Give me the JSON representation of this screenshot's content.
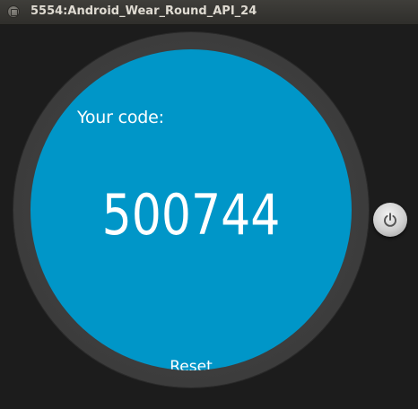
{
  "window": {
    "title": "5554:Android_Wear_Round_API_24",
    "close_icon": "window-close-icon"
  },
  "screen": {
    "background_color": "#0096c8",
    "prompt": "Your code:",
    "code": "500744",
    "reset_label": "Reset"
  },
  "side_button": {
    "icon": "power-icon"
  }
}
